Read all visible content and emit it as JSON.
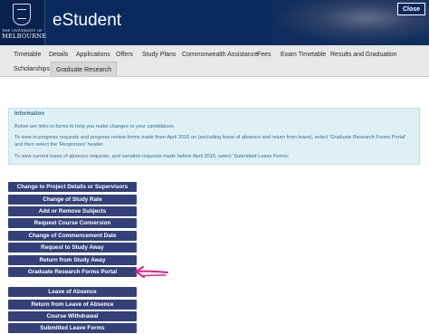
{
  "header": {
    "logo_line1": "THE UNIVERSITY OF",
    "logo_line2": "MELBOURNE",
    "app_title": "eStudent",
    "close_label": "Close"
  },
  "nav": {
    "row1": [
      "Timetable",
      "Details",
      "Applications",
      "Offers",
      "Study Plans",
      "Commonwealth Assistance",
      "Fees",
      "Exam Timetable",
      "Results and Graduation"
    ],
    "row2": [
      "Scholarships",
      "Graduate Research"
    ],
    "active_tab": "Graduate Research"
  },
  "info": {
    "heading": "Information",
    "paragraph1": "Below are links to forms to help you make changes to your candidature.",
    "paragraph2": "To view in-progress requests and progress review forms made from April 2016 on (excluding leave of absence and return from leave), select 'Graduate Research Forms Portal' and then select the 'Responses' header.",
    "paragraph3": "To view current leave of absence requests, and variation requests made before April 2016, select 'Submitted Leave Forms'."
  },
  "buttons": {
    "group1": [
      "Change to Project Details or Supervisors",
      "Change of Study Rate",
      "Add or Remove Subjects",
      "Request Course Conversion",
      "Change of Commencement Date",
      "Request to Study Away",
      "Return from Study Away",
      "Graduate Research Forms Portal"
    ],
    "group2": [
      "Leave of Absence",
      "Return from Leave of Absence",
      "Course Withdrawal",
      "Submitted Leave Forms"
    ]
  },
  "colors": {
    "header_bg": "#0a2a5e",
    "button_bg": "#34407a",
    "info_bg": "#dff0f5",
    "info_text": "#31708f",
    "annotation_arrow": "#e0218a"
  }
}
